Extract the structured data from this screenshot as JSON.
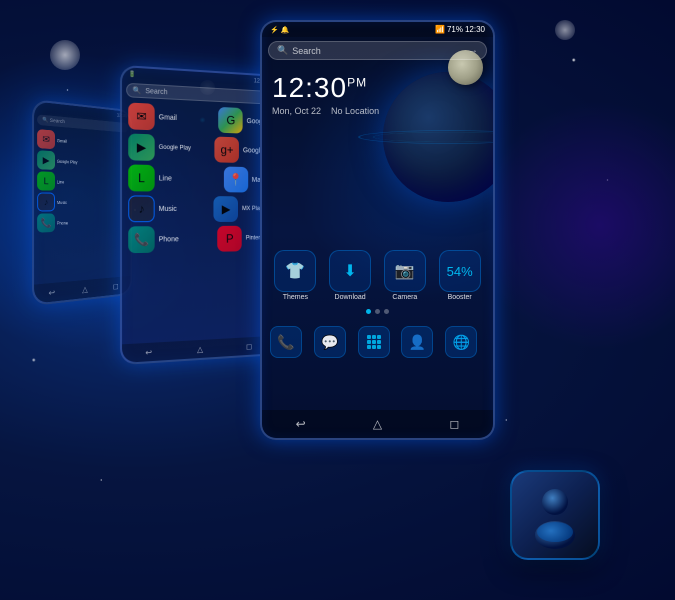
{
  "background": {
    "description": "Deep space blue cosmic background"
  },
  "phones": {
    "main": {
      "status_bar": {
        "signal": "all all",
        "battery": "71%",
        "time": "12:30"
      },
      "search": {
        "placeholder": "Search",
        "label": "Search"
      },
      "clock": {
        "time": "12:30",
        "ampm": "PM",
        "date": "Mon, Oct 22",
        "location": "No Location"
      },
      "app_rows": [
        {
          "apps": [
            {
              "name": "Themes",
              "icon": "🎨"
            },
            {
              "name": "Download",
              "icon": "⬇"
            },
            {
              "name": "Camera",
              "icon": "📷"
            },
            {
              "name": "Booster",
              "icon": "⚡"
            }
          ]
        }
      ],
      "dock": [
        {
          "name": "Phone",
          "icon": "📞"
        },
        {
          "name": "Message",
          "icon": "💬"
        },
        {
          "name": "Apps",
          "icon": "grid"
        },
        {
          "name": "Contacts",
          "icon": "👤"
        },
        {
          "name": "Browser",
          "icon": "🌐"
        }
      ],
      "nav": [
        "↩",
        "△",
        "◻"
      ]
    },
    "middle": {
      "search_label": "Search",
      "apps": [
        {
          "name": "Gmail",
          "icon": "✉",
          "class": "icon-gmail"
        },
        {
          "name": "Google",
          "icon": "G",
          "class": "icon-google"
        },
        {
          "name": "Google Play",
          "icon": "▶",
          "class": "icon-gplay"
        },
        {
          "name": "Google+",
          "icon": "g+",
          "class": "icon-gplus"
        },
        {
          "name": "Line",
          "icon": "L",
          "class": "icon-line"
        },
        {
          "name": "Maps",
          "icon": "📍",
          "class": "icon-maps"
        },
        {
          "name": "Music",
          "icon": "♪",
          "class": "icon-music"
        },
        {
          "name": "MX Player",
          "icon": "▶",
          "class": "icon-mxplayer"
        },
        {
          "name": "Phone",
          "icon": "📞",
          "class": "icon-phone"
        },
        {
          "name": "Pinterest",
          "icon": "P",
          "class": "icon-pinterest"
        }
      ]
    },
    "left": {
      "search_label": "Search",
      "apps": [
        {
          "name": "Gmail",
          "icon": "✉"
        },
        {
          "name": "Google Play",
          "icon": "▶"
        },
        {
          "name": "Line",
          "icon": "L"
        },
        {
          "name": "Music",
          "icon": "♪"
        },
        {
          "name": "Phone",
          "icon": "📞"
        }
      ]
    }
  },
  "contact_icon": {
    "label": "Contact",
    "icon": "👤"
  }
}
